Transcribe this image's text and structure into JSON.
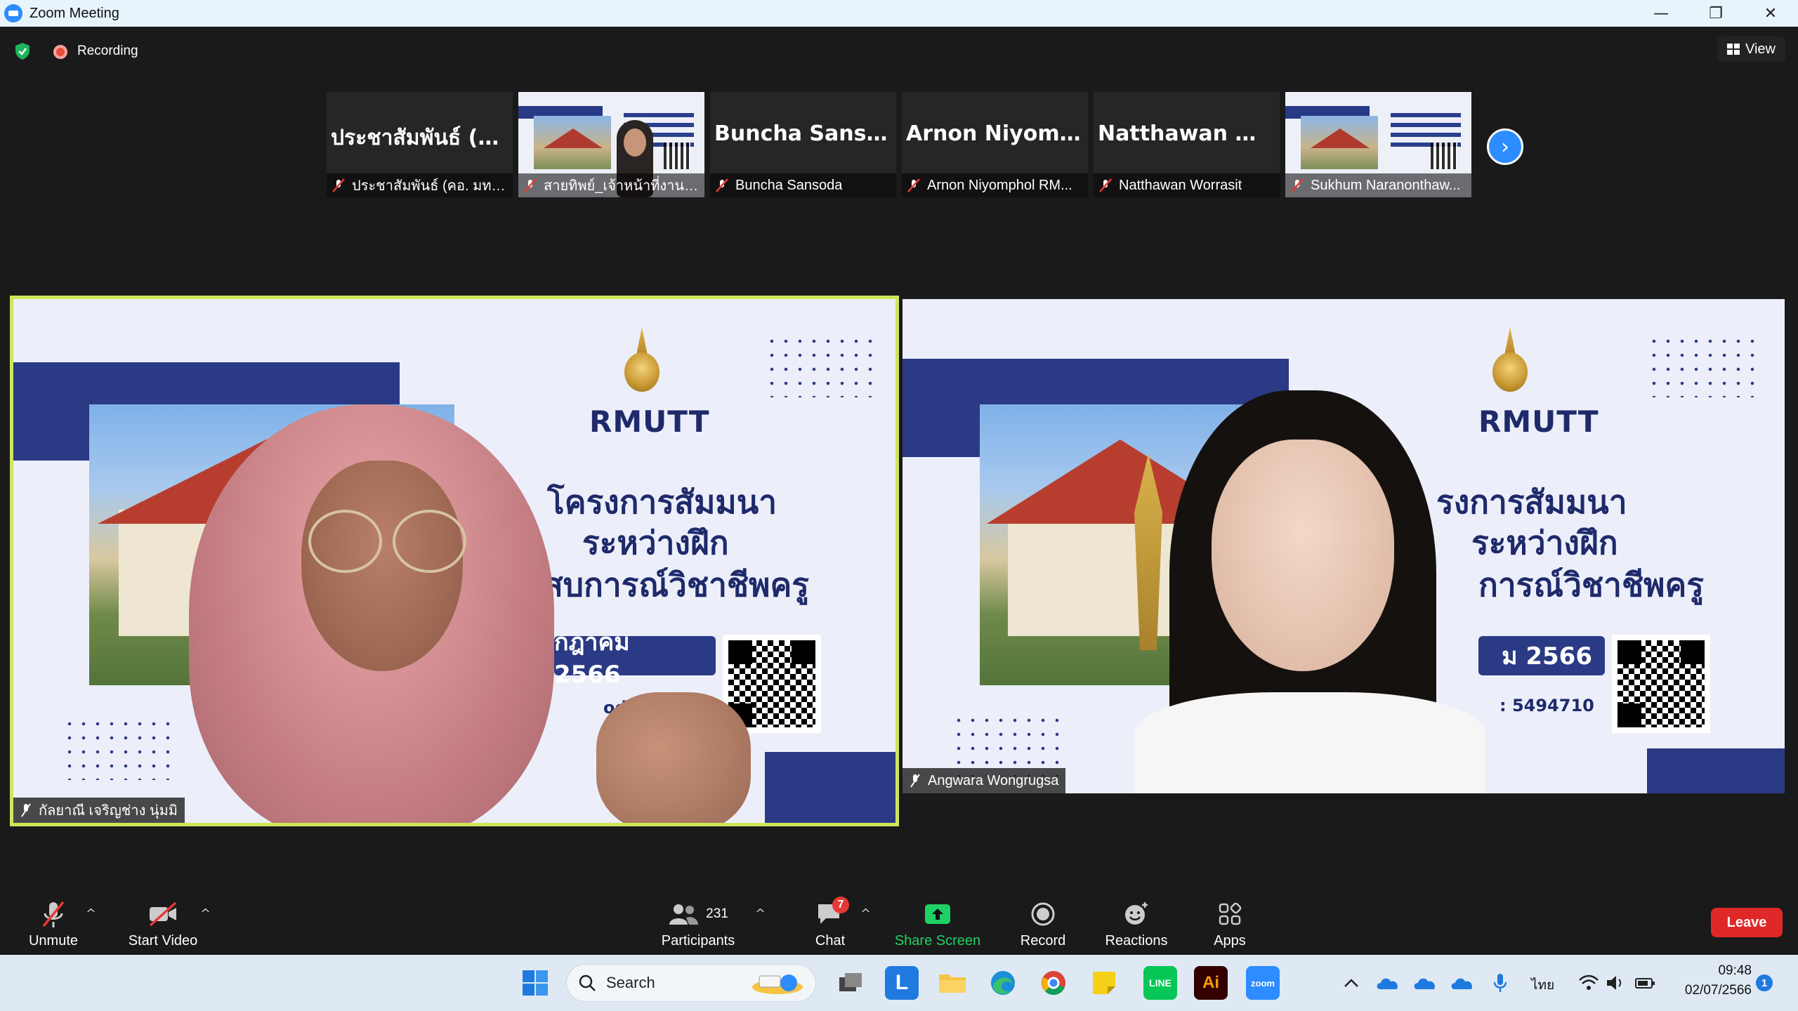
{
  "window": {
    "title": "Zoom Meeting",
    "minimize": "—",
    "restore": "❐",
    "close": "✕"
  },
  "top": {
    "recording_label": "Recording",
    "view_label": "View"
  },
  "filmstrip": [
    {
      "big_name": "ประชาสัมพันธ์ (ค...",
      "caption": "ประชาสัมพันธ์ (คอ. มทร.ธั...",
      "video": false
    },
    {
      "big_name": "",
      "caption": "สายทิพย์_เจ้าหน้าที่งานฝึก...",
      "video": true
    },
    {
      "big_name": "Buncha Sansoda",
      "caption": "Buncha Sansoda",
      "video": false
    },
    {
      "big_name": "Arnon Niyomph...",
      "caption": "Arnon Niyomphol RM...",
      "video": false
    },
    {
      "big_name": "Natthawan Wor...",
      "caption": "Natthawan Worrasit",
      "video": false
    },
    {
      "big_name": "",
      "caption": "Sukhum Naranonthaw...",
      "video": true
    }
  ],
  "slide_left": {
    "logo": "RMUTT",
    "line1": "โครงการสัมมนา",
    "line2": "ระหว่างฝึก",
    "line3": "ะสบการณ์วิชาชีพครู",
    "date": "กฎาคม 2566",
    "code": "ode : 54"
  },
  "slide_right": {
    "logo": "RMUTT",
    "line1": "รงการสัมมนา",
    "line2": "ระหว่างฝึก",
    "line3": "การณ์วิชาชีพครู",
    "date": "ม 2566",
    "code": ": 5494710"
  },
  "speakers": {
    "left_name": "กัลยาณี เจริญช่าง นุ่มมิ",
    "right_name": "Angwara Wongrugsa"
  },
  "toolbar": {
    "unmute": "Unmute",
    "start_video": "Start Video",
    "participants": "Participants",
    "participants_count": "231",
    "chat": "Chat",
    "chat_badge": "7",
    "share_screen": "Share Screen",
    "record": "Record",
    "reactions": "Reactions",
    "apps": "Apps",
    "leave": "Leave"
  },
  "taskbar": {
    "search_label": "Search",
    "lang": "ไทย",
    "time": "09:48",
    "date": "02/07/2566",
    "notif": "1"
  },
  "colors": {
    "accent": "#2d8cff",
    "active_speaker": "#cfe55c",
    "leave": "#e02828",
    "share": "#1fd164"
  }
}
